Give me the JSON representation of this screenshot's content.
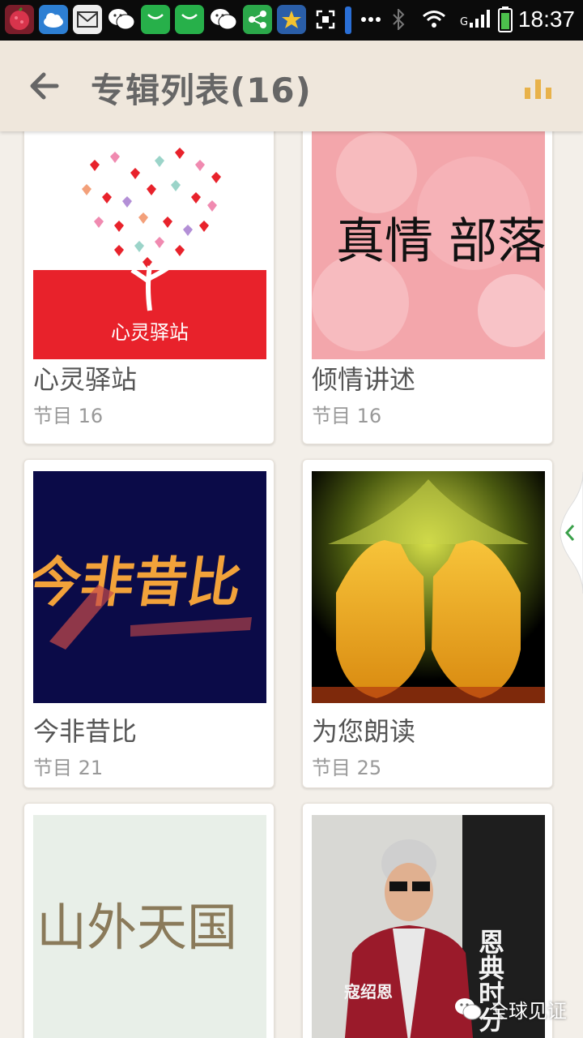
{
  "status_bar": {
    "time": "18:37",
    "network": "G",
    "icons": [
      "lychee-app-icon",
      "weather-cloud-icon",
      "mail-icon",
      "wechat-icon",
      "shopping-bag-icon",
      "shopping-bag-icon",
      "wechat-icon",
      "share-app-icon",
      "star-app-icon",
      "scan-icon",
      "more-dots-icon",
      "bluetooth-icon",
      "wifi-icon",
      "signal-icon",
      "battery-icon"
    ]
  },
  "header": {
    "title": "专辑列表(16)",
    "back_icon": "back-arrow-icon",
    "stats_icon": "bar-chart-icon",
    "accent": "#e8b24a"
  },
  "albums": [
    {
      "title": "心灵驿站",
      "count": "节目 16",
      "cover_text": "心灵驿站"
    },
    {
      "title": "倾情讲述",
      "count": "节目 16",
      "cover_text": "真情 部落格"
    },
    {
      "title": "今非昔比",
      "count": "节目 21",
      "cover_text": "今非昔比"
    },
    {
      "title": "为您朗读",
      "count": "节目 25"
    },
    {
      "title": "",
      "count": "",
      "cover_text": "山外天国"
    },
    {
      "title": "",
      "count": "",
      "cover_text": "恩典时分",
      "cover_name": "寇绍恩"
    }
  ],
  "watermark": {
    "text": "全球见证",
    "icon": "wechat-icon"
  },
  "side_tab_icon": "chevron-left-icon"
}
